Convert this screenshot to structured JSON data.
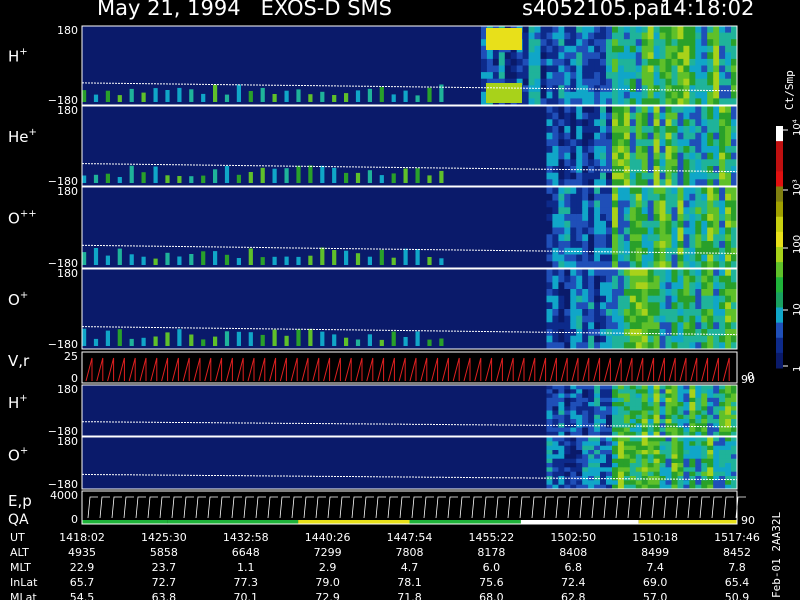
{
  "header": {
    "title": "May 21, 1994   EXOS-D SMS",
    "file": "s4052105.par",
    "time": "14:18:02"
  },
  "colorbar": {
    "unit": "Ct/Smp",
    "ticks": [
      "10⁴",
      "10³",
      "100",
      "10",
      "1"
    ]
  },
  "side_label": "Feb-01 2AA32L",
  "chart_data": {
    "type": "heatmap",
    "panels": [
      {
        "label": "H⁺",
        "sup": "+",
        "base": "H",
        "ymax": "180",
        "ymin": "−180"
      },
      {
        "label": "He⁺",
        "sup": "+",
        "base": "He",
        "ymax": "180",
        "ymin": "−180"
      },
      {
        "label": "O⁺⁺",
        "sup": "++",
        "base": "O",
        "ymax": "180",
        "ymin": "−180"
      },
      {
        "label": "O⁺",
        "sup": "+",
        "base": "O",
        "ymax": "180",
        "ymin": "−180"
      },
      {
        "label": "V,r",
        "sup": "",
        "base": "V,r",
        "ymax": "25",
        "ymin": "0",
        "right_top": "90",
        "right_bottom": "0"
      },
      {
        "label": "H⁺",
        "sup": "+",
        "base": "H",
        "ymax": "180",
        "ymin": "−180"
      },
      {
        "label": "O⁺",
        "sup": "+",
        "base": "O",
        "ymax": "180",
        "ymin": "−180"
      },
      {
        "label": "E,p QA",
        "sup": "",
        "base": "E,p",
        "base2": "QA",
        "ymax": "4000",
        "ymin": "0",
        "right_top": "90"
      }
    ],
    "ephemeris": {
      "row_labels": [
        "UT",
        "ALT",
        "MLT",
        "InLat",
        "MLat"
      ],
      "columns": [
        [
          "1418:02",
          "4935",
          "22.9",
          "65.7",
          "54.5"
        ],
        [
          "1425:30",
          "5858",
          "23.7",
          "72.7",
          "63.8"
        ],
        [
          "1432:58",
          "6648",
          "1.1",
          "77.3",
          "70.1"
        ],
        [
          "1440:26",
          "7299",
          "2.9",
          "79.0",
          "72.9"
        ],
        [
          "1447:54",
          "7808",
          "4.7",
          "78.1",
          "71.8"
        ],
        [
          "1455:22",
          "8178",
          "6.0",
          "75.6",
          "68.0"
        ],
        [
          "1502:50",
          "8408",
          "6.8",
          "72.4",
          "62.8"
        ],
        [
          "1510:18",
          "8499",
          "7.4",
          "69.0",
          "57.0"
        ],
        [
          "1517:46",
          "8452",
          "7.8",
          "65.4",
          "50.9"
        ]
      ]
    }
  }
}
